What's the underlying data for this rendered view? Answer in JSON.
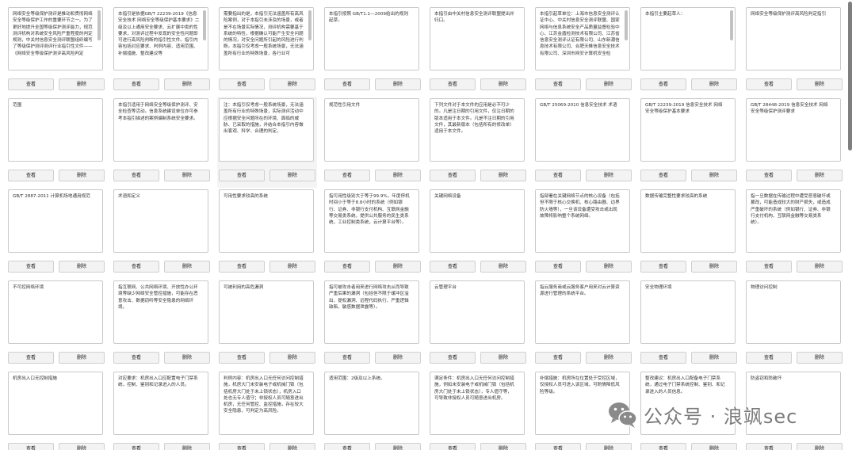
{
  "labels": {
    "view": "查看",
    "delete": "删除"
  },
  "watermark": {
    "text": "公众号 · 浪飒sec",
    "icon": "wechat-icon"
  },
  "cards": [
    {
      "text": "网络安全等级保护测评是推动和贯彻网络安全等级保护工作的重要环节之一。为了更好地提升全国等级保护测评能力，规范测评机构对系统安全风险严重程度的判定规则，中关村信息安全测评联盟组织编写了等级保护测评测评行业指引性文件——《网络安全等级保护测评高风险判定",
      "scroll": true
    },
    {
      "text": "本指引是依据GB/T 22239-2019《信息安全技术 网络安全等级保护基本要求》二级及以上通用安全要求、云扩展中类的性要求，对测评过程中发现的安全性问题即可进行高风险判断的指引性文件。指引内容包括对应要求、判例内容、适用范围、补偿措施、整改建议等",
      "scroll": true
    },
    {
      "text": "需要指出的是，本指引无法涵盖所有高风险案例，对于本指引未涉及的场景，或者是不在场景实际情况，测评机构需要基于系统的特性，根据确认可能产生安全问题的情况，对安全问题所引起的风险进行判断。本指引仅考虑一般系统场景，无法涵盖所有行业的特殊场景，各行业可",
      "scroll": true
    },
    {
      "text": "本指引按照 GB/T1.1—2009给出的规则起草。",
      "scroll": false
    },
    {
      "text": "本指引由中关村信息安全测评联盟提出并归口。",
      "scroll": false
    },
    {
      "text": "本指引起草单位：上海市信息安全测评认证中心、中关村信息安全测评联盟、国家网络与信息系统安全产品质量监督检验中心、江苏金盾检测技术有限公司、江苏省信息安全测评认证有限公司、山东新潮信息技术有限公司、合肥天帷信息安全技术有限公司、深圳市网安计算机安全检",
      "scroll": true
    },
    {
      "text": "本指引主要起草人：",
      "scroll": true
    },
    {
      "text": "网络安全等级保护测评高风险判定指引",
      "scroll": false
    },
    {
      "text": "范围",
      "scroll": false
    },
    {
      "text": "本指引适用于网络安全等级保护测评、安全检查等活动。信息系统建设单位亦可参考本指引描述的案例编制系统安全要求。",
      "scroll": false
    },
    {
      "text": "注：本指引仅考虑一般系统场景，无法涵盖所有行业的特殊场景，实际测评活动中应根据安全问题所在的环境、面临的威胁、已采取的措施，并结合本指引内容做出客观、科学、合理的判定。",
      "scroll": false,
      "hl": true
    },
    {
      "text": "规范性引用文件",
      "scroll": false
    },
    {
      "text": "下列文件对于本文件的应用是必不可少的。凡是注日期的引用文件，仅注日期的版本适用于本文件。凡是不注日期的引用文件，其最新版本（包括所有的修改单）适用于本文件。",
      "scroll": false
    },
    {
      "text": "GB/T 25069-2010 信息安全技术 术语",
      "scroll": false
    },
    {
      "text": "GB/T 22239-2019 信息安全技术 网络安全等级保护基本要求",
      "scroll": false
    },
    {
      "text": "GB/T 28448-2019 信息安全技术 网络安全等级保护测评要求",
      "scroll": false
    },
    {
      "text": "GB/T 2887-2011 计算机场地通用规范",
      "scroll": false
    },
    {
      "text": "术语和定义",
      "scroll": false
    },
    {
      "text": "可用性要求较高的系统",
      "scroll": false
    },
    {
      "text": "指可用性级别大于等于99.9%，年度停机时间小于等于8.8小时的系统（例如银行、证券、非银行支付机构、互联网金融等交易类系统，提供公共服务的民生类系统，工业控制类系统，云计算平台等）。",
      "scroll": false
    },
    {
      "text": "关键网络设备",
      "scroll": false
    },
    {
      "text": "指部署在关键网络节点的核心设备（包括但不限于核心交换机、核心路由器、边界防火墙等），一旦该设备遭受攻击或出现故障将影响整个系统网络。",
      "scroll": false
    },
    {
      "text": "数据传输完整性要求较高的系统",
      "scroll": false
    },
    {
      "text": "指一旦数据在传输过程中遭受恶意破坏或篡改，可能造成较大的财产损失，或造成严重破坏的系统（例如银行、证券、非银行支付机构、互联网金融等交易类系统）。",
      "scroll": false
    },
    {
      "text": "不可控网络环境",
      "scroll": false
    },
    {
      "text": "指互联网、公共网络环境、开放性办公环境等缺少网络安全管控措施，可能存在恶意攻击、数据窃听等安全隐患的网络环境。",
      "scroll": false
    },
    {
      "text": "可被利用的高危漏洞",
      "scroll": false
    },
    {
      "text": "指可被攻击者用来进行网络攻击从而导致严重后果的漏洞（包括但不限于缓冲区溢出、提权漏洞、远程代码执行、严重逻辑缺陷、敏感数据泄露等）。",
      "scroll": false
    },
    {
      "text": "云管理平台",
      "scroll": false
    },
    {
      "text": "指云服务商或云服务客户用来对云计算资源进行管理的系统平台。",
      "scroll": false
    },
    {
      "text": "安全物理环境",
      "scroll": false
    },
    {
      "text": "物理访问控制",
      "scroll": false
    },
    {
      "text": "机房出入口无控制措施",
      "scroll": false
    },
    {
      "text": "对应要求：机房出入口应配置电子门禁系统，控制、鉴别和记录进入的人员。",
      "scroll": false
    },
    {
      "text": "判例内容：机房出入口无任何访问控制措施，机房大门未安装电子或机械门锁（包括机房大门处于未上锁状态），机房入口处也无专人值守；非授权人员可随意进出机房，无任何管控、监控措施，存在较大安全隐患，可判定为高风险。",
      "scroll": false
    },
    {
      "text": "适用范围：2级及以上系统。",
      "scroll": false
    },
    {
      "text": "满足条件：机房出入口无任何访问控制措施，例如未安装电子或机械门锁（包括机房大门处于未上锁状态），专人值守等，可导致非授权人员可随意进出机房。",
      "scroll": false
    },
    {
      "text": "补偿措施：机房所在位置处于受控区域，仅授权人员可进入该区域，可酌情降低风险等级。",
      "scroll": false
    },
    {
      "text": "整改建议：机房出入口配备电子门禁系统，通过电子门禁系统控制、鉴别、和记录进入的人员信息。",
      "scroll": false
    },
    {
      "text": "防盗窃和防破坏",
      "scroll": false
    }
  ]
}
